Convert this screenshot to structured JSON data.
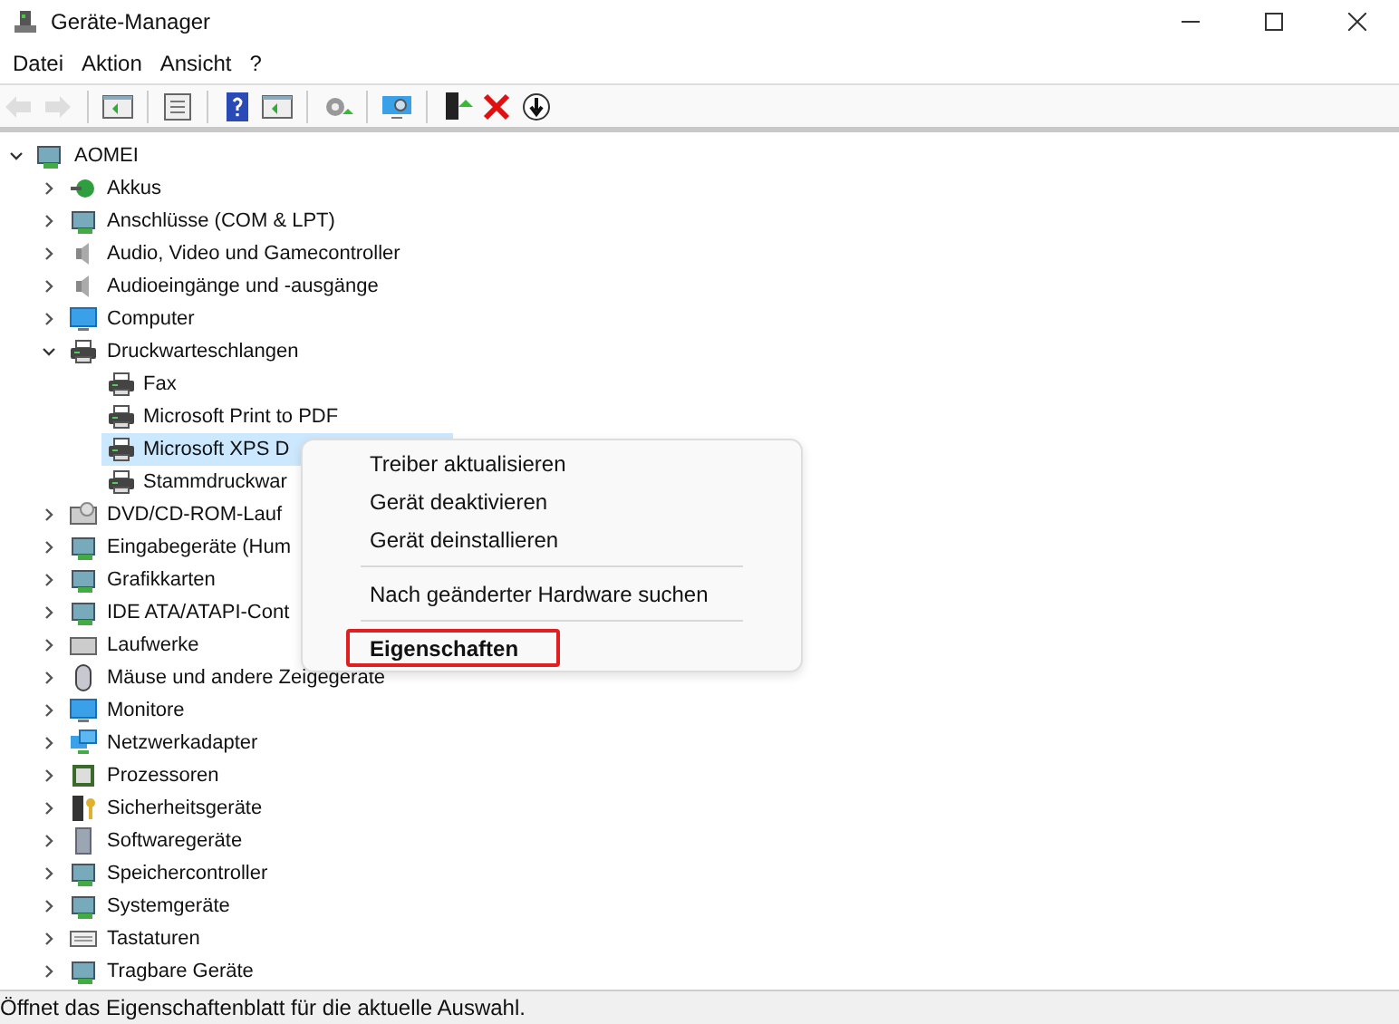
{
  "window": {
    "title": "Geräte-Manager"
  },
  "menu_bar": [
    "Datei",
    "Aktion",
    "Ansicht",
    "?"
  ],
  "toolbar": [
    {
      "disabled": true
    },
    {
      "disabled": true
    },
    {
      "disabled": false
    },
    {
      "disabled": false
    },
    {
      "disabled": false
    },
    {
      "disabled": false
    },
    {
      "disabled": false
    },
    {
      "disabled": false
    },
    {
      "disabled": false
    },
    {
      "disabled": false
    },
    {
      "disabled": false
    }
  ],
  "tree": {
    "label": "AOMEI",
    "expanded": true,
    "children": [
      {
        "label": "Akkus",
        "expanded": false
      },
      {
        "label": "Anschlüsse (COM & LPT)",
        "expanded": false
      },
      {
        "label": "Audio, Video und Gamecontroller",
        "expanded": false
      },
      {
        "label": "Audioeingänge und -ausgänge",
        "expanded": false
      },
      {
        "label": "Computer",
        "expanded": false
      },
      {
        "label": "Druckwarteschlangen",
        "expanded": true,
        "children": [
          {
            "label": "Fax",
            "selected": false
          },
          {
            "label": "Microsoft Print to PDF",
            "selected": false
          },
          {
            "label": "Microsoft XPS D",
            "selected": true
          },
          {
            "label": "Stammdruckwar",
            "selected": false
          }
        ]
      },
      {
        "label": "DVD/CD-ROM-Lauf",
        "expanded": false
      },
      {
        "label": "Eingabegeräte (Hum",
        "expanded": false
      },
      {
        "label": "Grafikkarten",
        "expanded": false
      },
      {
        "label": "IDE ATA/ATAPI-Cont",
        "expanded": false
      },
      {
        "label": "Laufwerke",
        "expanded": false
      },
      {
        "label": "Mäuse und andere Zeigegeräte",
        "expanded": false
      },
      {
        "label": "Monitore",
        "expanded": false
      },
      {
        "label": "Netzwerkadapter",
        "expanded": false
      },
      {
        "label": "Prozessoren",
        "expanded": false
      },
      {
        "label": "Sicherheitsgeräte",
        "expanded": false
      },
      {
        "label": "Softwaregeräte",
        "expanded": false
      },
      {
        "label": "Speichercontroller",
        "expanded": false
      },
      {
        "label": "Systemgeräte",
        "expanded": false
      },
      {
        "label": "Tastaturen",
        "expanded": false
      },
      {
        "label": "Tragbare Geräte",
        "expanded": false
      }
    ]
  },
  "context_menu": [
    {
      "kind": "item",
      "label": "Treiber aktualisieren",
      "highlighted": false
    },
    {
      "kind": "item",
      "label": "Gerät deaktivieren",
      "highlighted": false
    },
    {
      "kind": "item",
      "label": "Gerät deinstallieren",
      "highlighted": false
    },
    {
      "kind": "separator"
    },
    {
      "kind": "item",
      "label": "Nach geänderter Hardware suchen",
      "highlighted": false
    },
    {
      "kind": "separator"
    },
    {
      "kind": "item",
      "label": "Eigenschaften",
      "highlighted": true
    }
  ],
  "status_bar": "Öffnet das Eigenschaftenblatt für die aktuelle Auswahl."
}
